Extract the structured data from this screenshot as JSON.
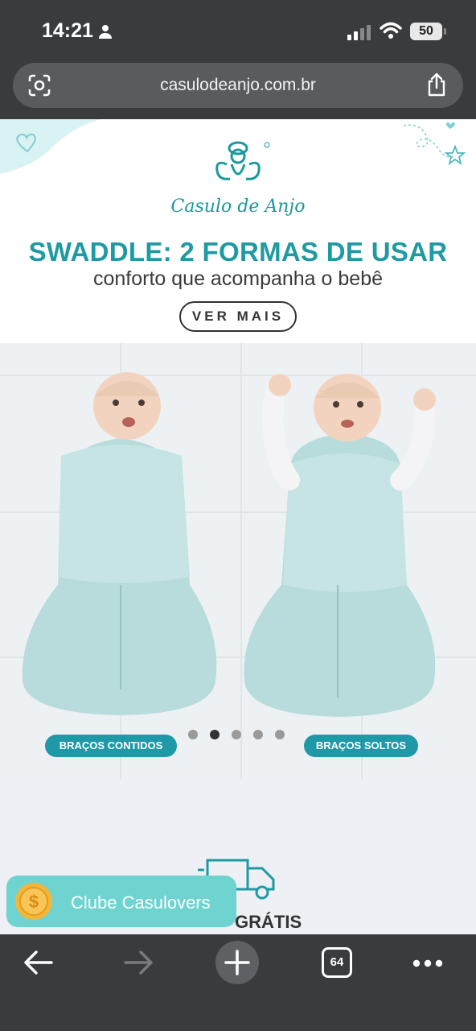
{
  "status": {
    "time": "14:21",
    "battery": "50"
  },
  "browser": {
    "url": "casulodeanjo.com.br",
    "tab_count": "64"
  },
  "banner": {
    "brand": "Casulo de Anjo",
    "headline": "SWADDLE: 2 FORMAS DE USAR",
    "subheadline": "conforto que acompanha o bebê",
    "cta": "VER MAIS"
  },
  "carousel": {
    "left_label": "BRAÇOS CONTIDOS",
    "right_label": "BRAÇOS SOLTOS",
    "active_slide": 2,
    "slide_count": 5
  },
  "shipping": {
    "label": "GRÁTIS"
  },
  "club": {
    "label": "Clube Casulovers"
  },
  "colors": {
    "accent": "#1f9aa3",
    "club": "#6fd3d0",
    "chrome": "#3a3b3d"
  },
  "icons": [
    "person-icon",
    "signal-icon",
    "wifi-icon",
    "lens-icon",
    "share-icon",
    "logo-icon",
    "heart-icon",
    "star-icon",
    "truck-icon",
    "coin-icon",
    "back-icon",
    "forward-icon",
    "plus-icon",
    "more-icon"
  ]
}
